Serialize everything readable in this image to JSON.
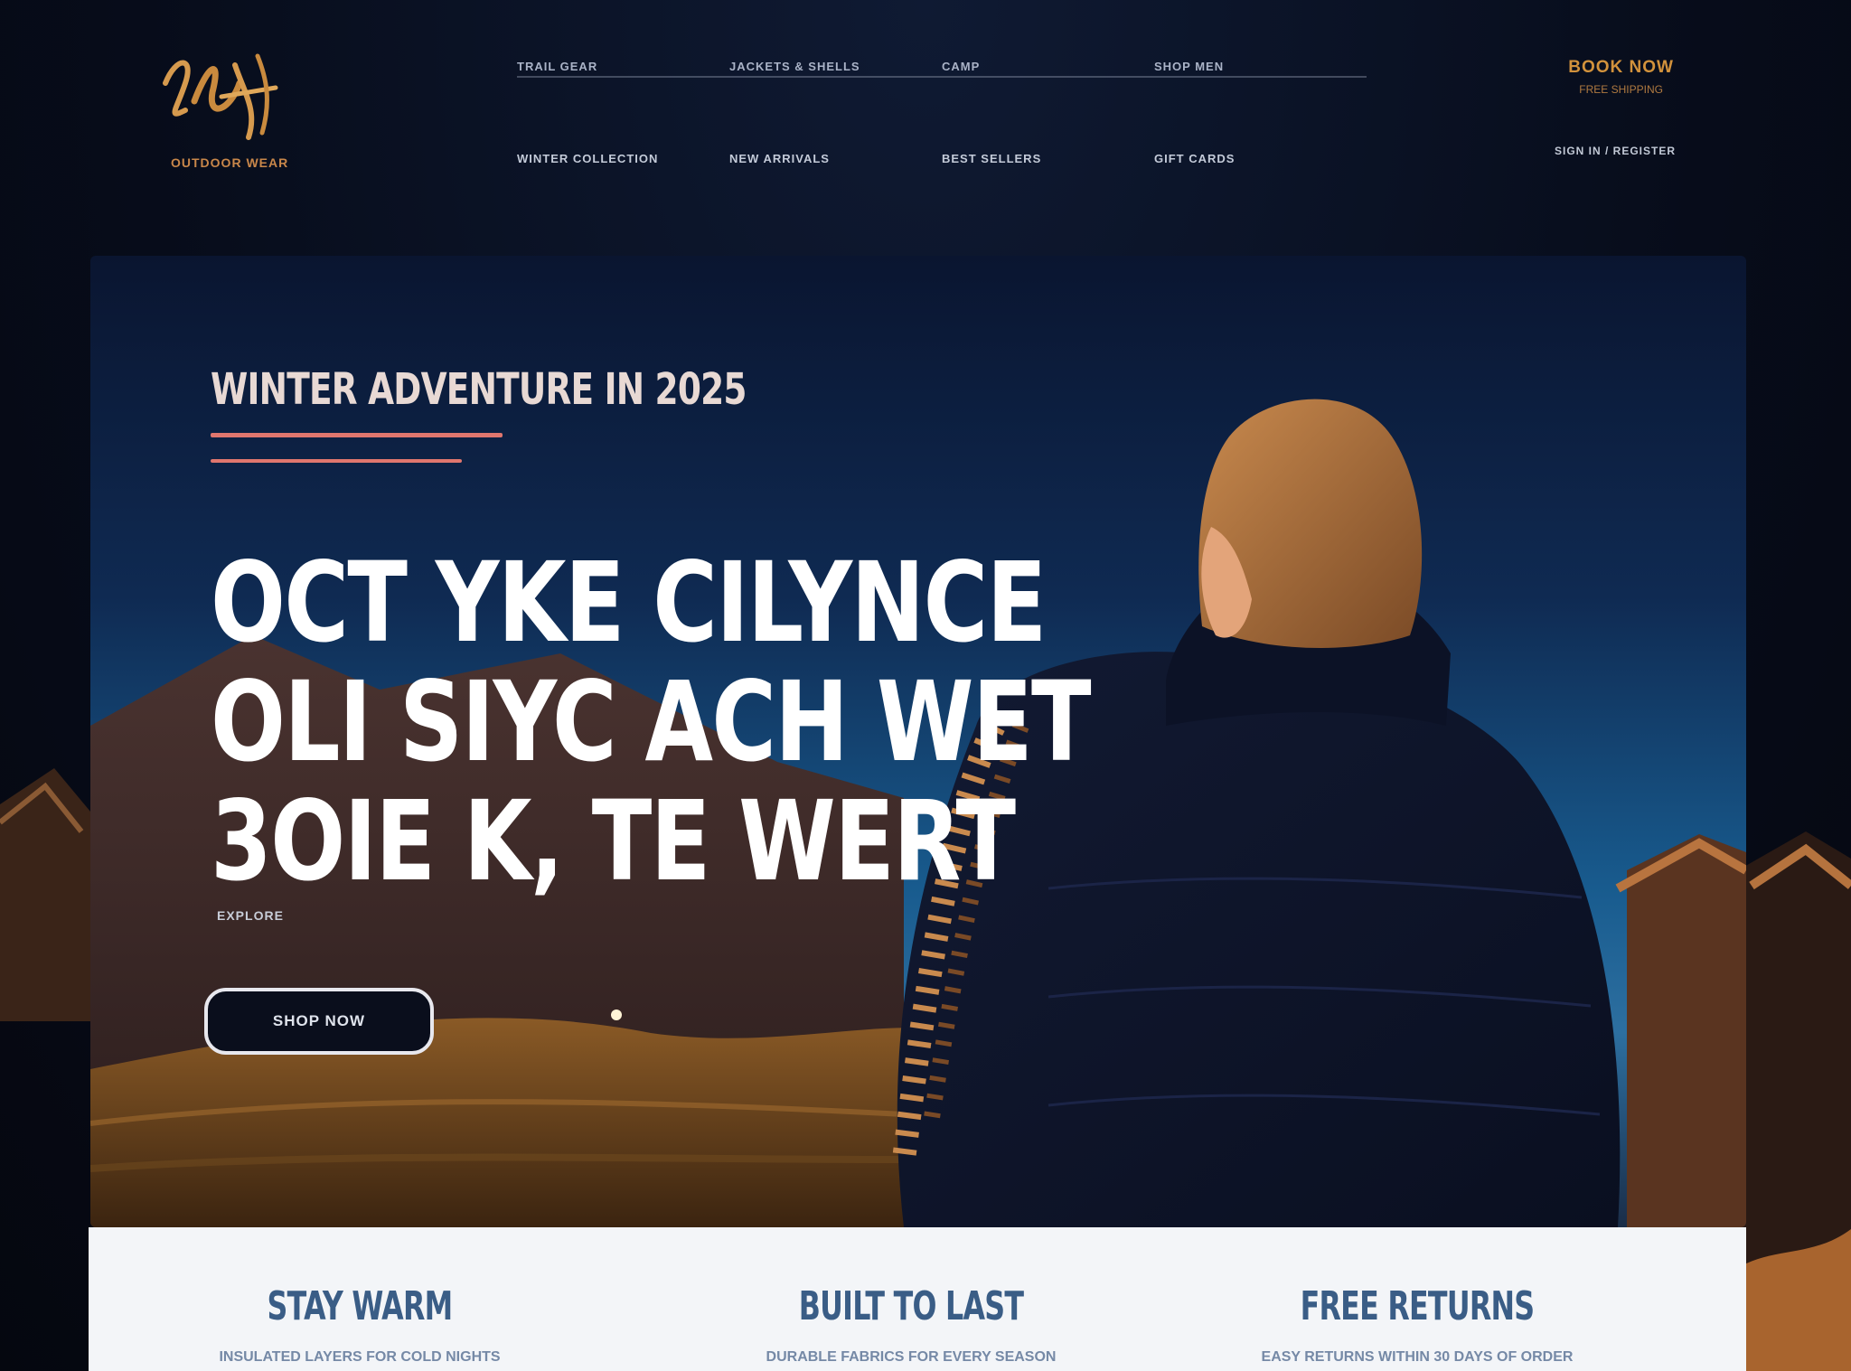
{
  "brand": {
    "tagline": "OUTDOOR WEAR"
  },
  "nav": {
    "top": [
      "TRAIL GEAR",
      "JACKETS & SHELLS",
      "CAMP",
      "SHOP MEN"
    ],
    "bottom": [
      "WINTER COLLECTION",
      "NEW ARRIVALS",
      "BEST SELLERS",
      "GIFT CARDS"
    ]
  },
  "header": {
    "cta_main": "BOOK NOW",
    "cta_small": "FREE SHIPPING",
    "secondary_link": "SIGN IN / REGISTER"
  },
  "hero": {
    "eyebrow": "WINTER ADVENTURE IN 2025",
    "headline": [
      "OCT YKE CILYNCE",
      "OLI SIYC ACH WET",
      "3OIE K, TE WERT"
    ],
    "small_tag": "EXPLORE",
    "button_label": "SHOP NOW"
  },
  "features": [
    {
      "title": "STAY WARM",
      "text": "INSULATED LAYERS FOR COLD NIGHTS"
    },
    {
      "title": "BUILT TO LAST",
      "text": "DURABLE FABRICS FOR EVERY SEASON"
    },
    {
      "title": "FREE RETURNS",
      "text": "EASY RETURNS WITHIN 30 DAYS OF ORDER"
    }
  ],
  "colors": {
    "accent_orange": "#d2923c",
    "accent_coral": "#e0766e",
    "feature_blue": "#3a5d86",
    "page_bg": "#070c1a"
  }
}
